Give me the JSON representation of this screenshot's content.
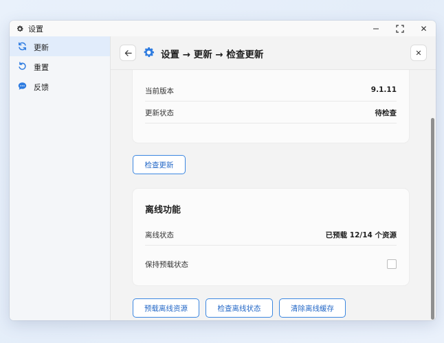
{
  "window": {
    "title": "设置",
    "controls": {
      "minimize": "—",
      "maximize": "⛶",
      "close": "✕"
    }
  },
  "sidebar": {
    "items": [
      {
        "label": "更新",
        "icon": "refresh-icon",
        "active": true
      },
      {
        "label": "重置",
        "icon": "reset-icon",
        "active": false
      },
      {
        "label": "反馈",
        "icon": "feedback-icon",
        "active": false
      }
    ]
  },
  "header": {
    "title": "设置 → 更新 → 检查更新",
    "back": "←",
    "close": "✕"
  },
  "update_card": {
    "rows": [
      {
        "label": "当前版本",
        "value": "9.1.11"
      },
      {
        "label": "更新状态",
        "value": "待检查"
      }
    ]
  },
  "check_update_button": "检查更新",
  "offline_card": {
    "title": "离线功能",
    "status_label": "离线状态",
    "status_value": "已预载 12/14 个资源",
    "keep_label": "保持预载状态",
    "keep_checked": false
  },
  "actions": {
    "preload": "预载离线资源",
    "check_offline": "检查离线状态",
    "clear_cache": "清除离线缓存"
  },
  "colors": {
    "accent": "#2d7be0",
    "active_bg": "#e1ecfb"
  }
}
